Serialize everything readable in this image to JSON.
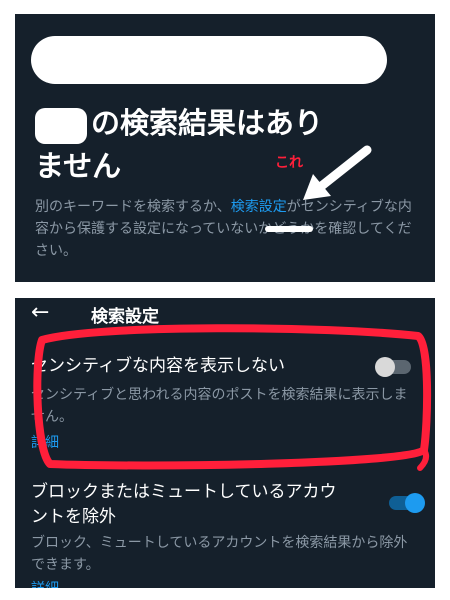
{
  "top_panel": {
    "title_part1": "の検索結果はあり",
    "title_part2": "ません",
    "description_before": "別のキーワードを検索するか、",
    "search_settings_link": "検索設定",
    "description_after": "がセンシティブな内容から保護する設定になっていないかどうかを確認してください。",
    "annotation_label": "これ"
  },
  "bottom_panel": {
    "header_title": "検索設定",
    "settings": [
      {
        "title": "センシティブな内容を表示しない",
        "description": "センシティブと思われる内容のポストを検索結果に表示しません。",
        "link": "詳細",
        "toggle_on": false
      },
      {
        "title": "ブロックまたはミュートしているアカウントを除外",
        "description": "ブロック、ミュートしているアカウントを検索結果から除外できます。",
        "link": "詳細",
        "toggle_on": true
      }
    ]
  },
  "colors": {
    "background": "#15202b",
    "accent": "#1d9bf0",
    "annotation": "#ff1f3a",
    "secondary_text": "#8b98a5"
  }
}
